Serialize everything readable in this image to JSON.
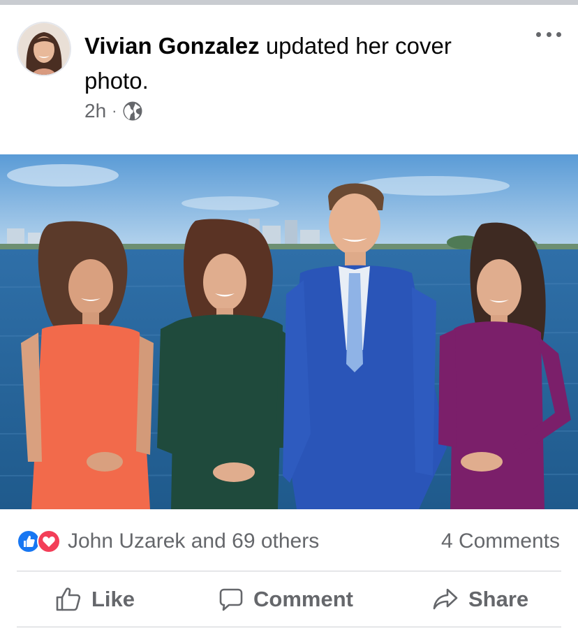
{
  "post": {
    "author_name": "Vivian Gonzalez",
    "action_text": "updated her cover photo.",
    "time": "2h",
    "separator": "·",
    "privacy_icon": "globe-icon",
    "more_icon": "more-options-icon"
  },
  "reactions": {
    "icons": [
      "like-reaction-icon",
      "love-reaction-icon"
    ],
    "summary": "John Uzarek and 69 others",
    "comments": "4 Comments"
  },
  "actions": [
    {
      "label": "Like",
      "icon": "thumbs-up-icon"
    },
    {
      "label": "Comment",
      "icon": "comment-bubble-icon"
    },
    {
      "label": "Share",
      "icon": "share-arrow-icon"
    }
  ],
  "colors": {
    "like_blue": "#1877f2",
    "love_red": "#f33e58",
    "secondary_text": "#65676b",
    "primary_text": "#050505"
  }
}
